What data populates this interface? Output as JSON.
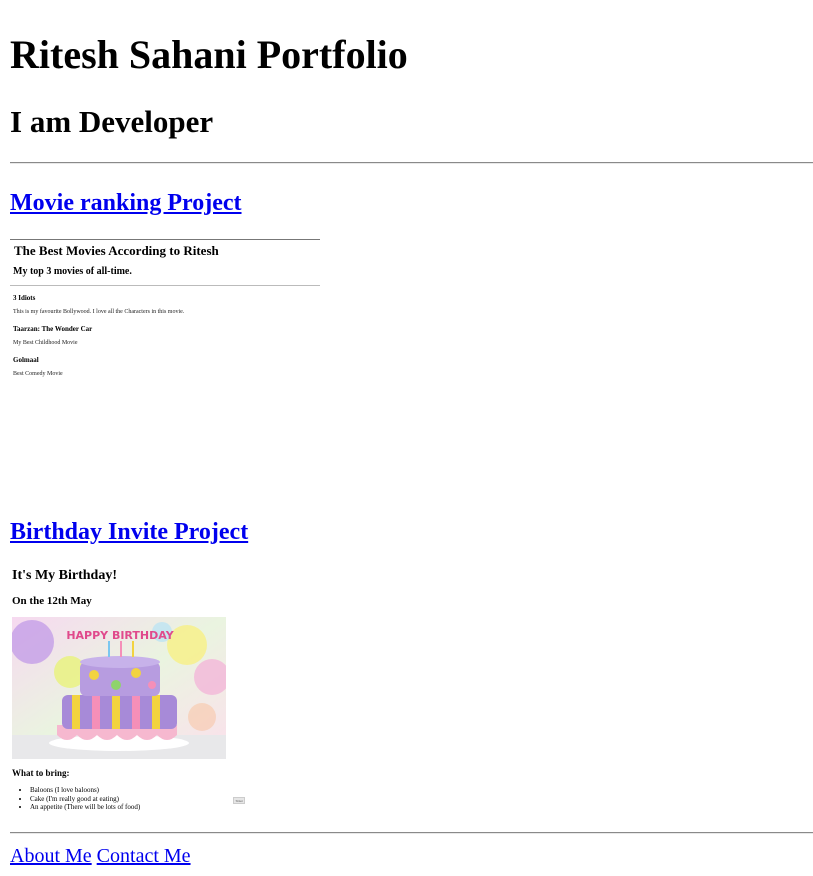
{
  "page": {
    "title": "Ritesh Sahani Portfolio",
    "subtitle": "I am Developer"
  },
  "projects": {
    "movie": {
      "link_label": "Movie ranking Project",
      "title": "The Best Movies According to Ritesh",
      "subtitle": "My top 3 movies of all-time.",
      "movies": [
        {
          "name": "3 Idiots",
          "description": "This is my favourite Bollywood. I love all the Characters in this movie."
        },
        {
          "name": "Taarzan: The Wonder Car",
          "description": "My Best Childhood Movie"
        },
        {
          "name": "Golmaal",
          "description": "Best Comedy Movie"
        }
      ]
    },
    "birthday": {
      "link_label": "Birthday Invite Project",
      "title": "It's My Birthday!",
      "date": "On the 12th May",
      "cake_text": "HAPPY BIRTHDAY",
      "bring_title": "What to bring:",
      "items": [
        "Baloons (I love baloons)",
        "Cake (I'm really good at eating)",
        "An appetite (There will be lots of food)"
      ],
      "button_label": "Ticket"
    }
  },
  "footer": {
    "about": "About Me",
    "contact": "Contact Me"
  }
}
